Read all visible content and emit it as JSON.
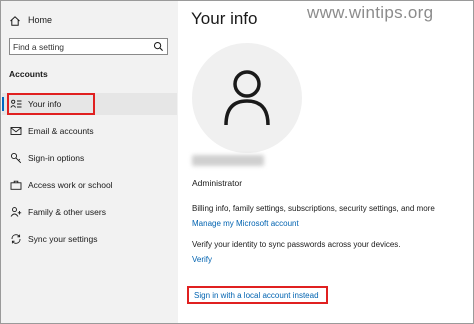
{
  "sidebar": {
    "home_label": "Home",
    "search_placeholder": "Find a setting",
    "section_title": "Accounts",
    "items": [
      {
        "label": "Your info",
        "icon": "person-card-icon",
        "selected": true
      },
      {
        "label": "Email & accounts",
        "icon": "mail-icon"
      },
      {
        "label": "Sign-in options",
        "icon": "key-icon"
      },
      {
        "label": "Access work or school",
        "icon": "briefcase-icon"
      },
      {
        "label": "Family & other users",
        "icon": "person-add-icon"
      },
      {
        "label": "Sync your settings",
        "icon": "sync-icon"
      }
    ]
  },
  "main": {
    "title": "Your info",
    "watermark": "www.wintips.org",
    "role": "Administrator",
    "billing_text": "Billing info, family settings, subscriptions, security settings, and more",
    "manage_link": "Manage my Microsoft account",
    "verify_text": "Verify your identity to sync passwords across your devices.",
    "verify_link": "Verify",
    "local_account_link": "Sign in with a local account instead"
  },
  "colors": {
    "accent": "#0067c0",
    "link": "#0063b1",
    "highlight_box": "#e02020",
    "sidebar_bg": "#f2f2f2"
  }
}
